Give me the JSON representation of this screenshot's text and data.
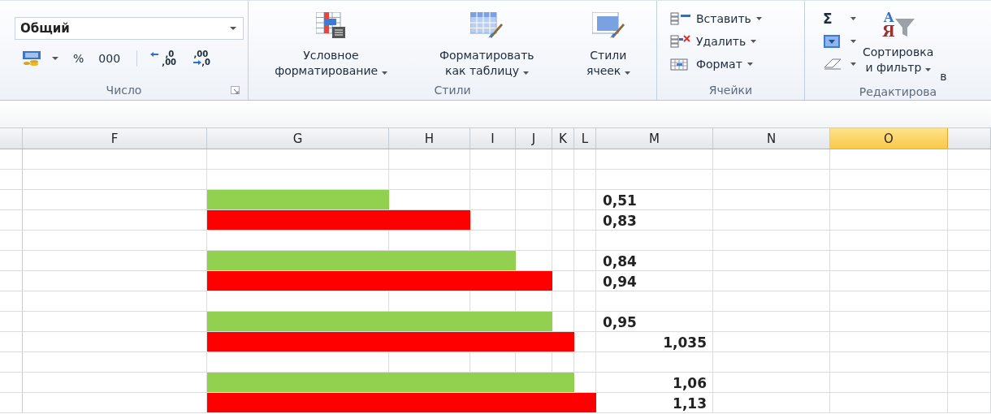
{
  "ribbon": {
    "number": {
      "format": "Общий",
      "percent": "%",
      "thousands": "000",
      "increase_decimal": [
        ",0",
        ",00"
      ],
      "decrease_decimal": [
        ",00",
        ",0"
      ],
      "label": "Число"
    },
    "styles": {
      "buttons": [
        {
          "kind": "conditional",
          "lines": [
            "Условное",
            "форматирование"
          ]
        },
        {
          "kind": "table",
          "lines": [
            "Форматировать",
            "как таблицу"
          ]
        },
        {
          "kind": "cell",
          "lines": [
            "Стили",
            "ячеек"
          ]
        }
      ],
      "label": "Стили"
    },
    "cells": {
      "buttons": [
        {
          "kind": "insert",
          "label": "Вставить"
        },
        {
          "kind": "delete",
          "label": "Удалить"
        },
        {
          "kind": "format",
          "label": "Формат"
        }
      ],
      "label": "Ячейки"
    },
    "editing": {
      "sum": "Σ",
      "sort_glyphs": [
        "A",
        "Я"
      ],
      "sort_lines": [
        "Сортировка",
        "и фильтр"
      ],
      "cut_button": "в",
      "label": "Редактирова"
    }
  },
  "sheet": {
    "columns": [
      {
        "label": "F",
        "selected": false
      },
      {
        "label": "G",
        "selected": false
      },
      {
        "label": "H",
        "selected": false
      },
      {
        "label": "I",
        "selected": false
      },
      {
        "label": "J",
        "selected": false
      },
      {
        "label": "K",
        "selected": false
      },
      {
        "label": "L",
        "selected": false
      },
      {
        "label": "M",
        "selected": false
      },
      {
        "label": "N",
        "selected": false
      },
      {
        "label": "O",
        "selected": true
      }
    ],
    "rows": [
      {
        "kind": "blank"
      },
      {
        "kind": "blank"
      },
      {
        "kind": "bar",
        "color": "#92d050",
        "value": "0,51"
      },
      {
        "kind": "bar",
        "color": "#ff0000",
        "value": "0,83"
      },
      {
        "kind": "blank"
      },
      {
        "kind": "bar",
        "color": "#92d050",
        "value": "0,84"
      },
      {
        "kind": "bar",
        "color": "#ff0000",
        "value": "0,94"
      },
      {
        "kind": "blank"
      },
      {
        "kind": "bar",
        "color": "#92d050",
        "value": "0,95"
      },
      {
        "kind": "bar",
        "color": "#ff0000",
        "value": "1,035"
      },
      {
        "kind": "blank"
      },
      {
        "kind": "bar",
        "color": "#92d050",
        "value": "1,06"
      },
      {
        "kind": "bar",
        "color": "#ff0000",
        "value": "1,13"
      }
    ]
  }
}
